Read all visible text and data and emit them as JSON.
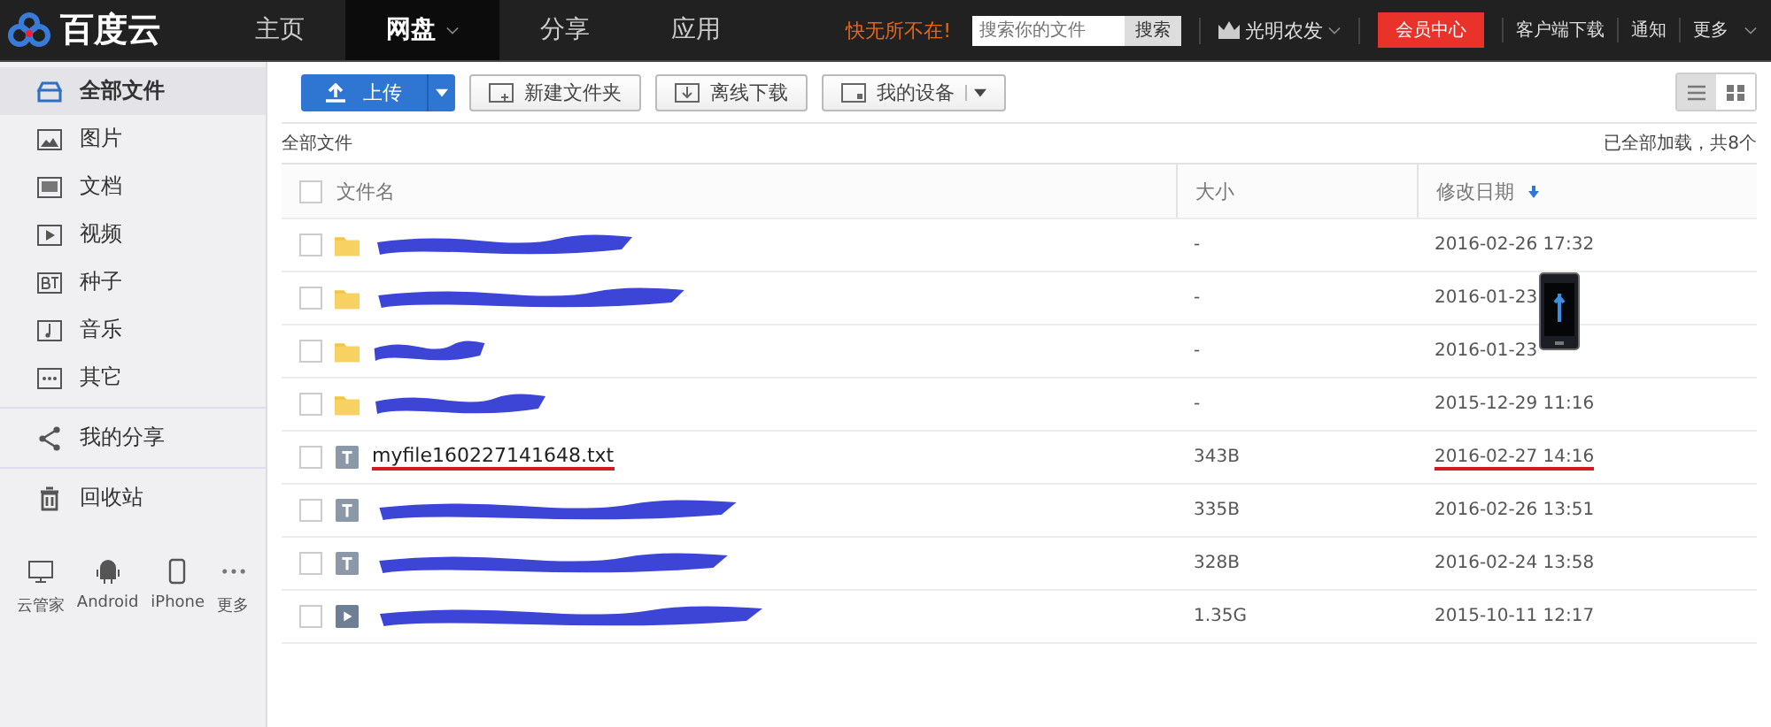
{
  "topbar": {
    "logo": "百度云",
    "nav": [
      {
        "label": "主页",
        "selected": false
      },
      {
        "label": "网盘",
        "selected": true,
        "dropdown": true
      },
      {
        "label": "分享",
        "selected": false
      },
      {
        "label": "应用",
        "selected": false
      }
    ],
    "slogan": "快无所不在!",
    "search": {
      "placeholder": "搜索你的文件",
      "button": "搜索"
    },
    "user": "光明农发",
    "vip": "会员中心",
    "links": [
      "客户端下载",
      "通知",
      "更多"
    ]
  },
  "sidebar": {
    "items": [
      {
        "label": "全部文件",
        "kind": "all",
        "selected": true
      },
      {
        "label": "图片",
        "kind": "image",
        "selected": false
      },
      {
        "label": "文档",
        "kind": "doc",
        "selected": false
      },
      {
        "label": "视频",
        "kind": "video",
        "selected": false
      },
      {
        "label": "种子",
        "kind": "bt",
        "selected": false
      },
      {
        "label": "音乐",
        "kind": "music",
        "selected": false
      },
      {
        "label": "其它",
        "kind": "other",
        "selected": false
      }
    ],
    "extra": [
      {
        "label": "我的分享",
        "kind": "share"
      },
      {
        "label": "回收站",
        "kind": "trash"
      }
    ],
    "devices": [
      {
        "label": "云管家",
        "kind": "pc"
      },
      {
        "label": "Android",
        "kind": "android"
      },
      {
        "label": "iPhone",
        "kind": "iphone"
      },
      {
        "label": "更多",
        "kind": "more"
      }
    ]
  },
  "toolbar": {
    "upload": "上传",
    "buttons": [
      {
        "label": "新建文件夹",
        "kind": "folder",
        "dropdown": false
      },
      {
        "label": "离线下载",
        "kind": "download",
        "dropdown": false
      },
      {
        "label": "我的设备",
        "kind": "device",
        "dropdown": true
      }
    ],
    "view": [
      {
        "kind": "list",
        "selected": true
      },
      {
        "kind": "grid",
        "selected": false
      }
    ]
  },
  "breadcrumb": "全部文件",
  "status": "已全部加载，共8个",
  "table": {
    "all_checked": false,
    "columns": [
      "文件名",
      "大小",
      "修改日期"
    ],
    "rows": [
      {
        "kind": "folder",
        "checked": false,
        "redacted": true,
        "size": "-",
        "date": "2016-02-26 17:32",
        "underlined": false
      },
      {
        "kind": "folder",
        "checked": false,
        "redacted": true,
        "size": "-",
        "date": "2016-01-23",
        "underlined": false
      },
      {
        "kind": "folder",
        "checked": false,
        "redacted": true,
        "size": "-",
        "date": "2016-01-23",
        "underlined": false
      },
      {
        "kind": "folder",
        "checked": false,
        "redacted": true,
        "size": "-",
        "date": "2015-12-29 11:16",
        "underlined": false
      },
      {
        "kind": "text",
        "checked": false,
        "redacted": false,
        "name": "myfile160227141648.txt",
        "size": "343B",
        "date": "2016-02-27 14:16",
        "underlined": true
      },
      {
        "kind": "text",
        "checked": false,
        "redacted": true,
        "size": "335B",
        "date": "2016-02-26 13:51",
        "underlined": false
      },
      {
        "kind": "text",
        "checked": false,
        "redacted": true,
        "size": "328B",
        "date": "2016-02-24 13:58",
        "underlined": false
      },
      {
        "kind": "video",
        "checked": false,
        "redacted": true,
        "size": "1.35G",
        "date": "2015-10-11 12:17",
        "underlined": false
      }
    ]
  }
}
